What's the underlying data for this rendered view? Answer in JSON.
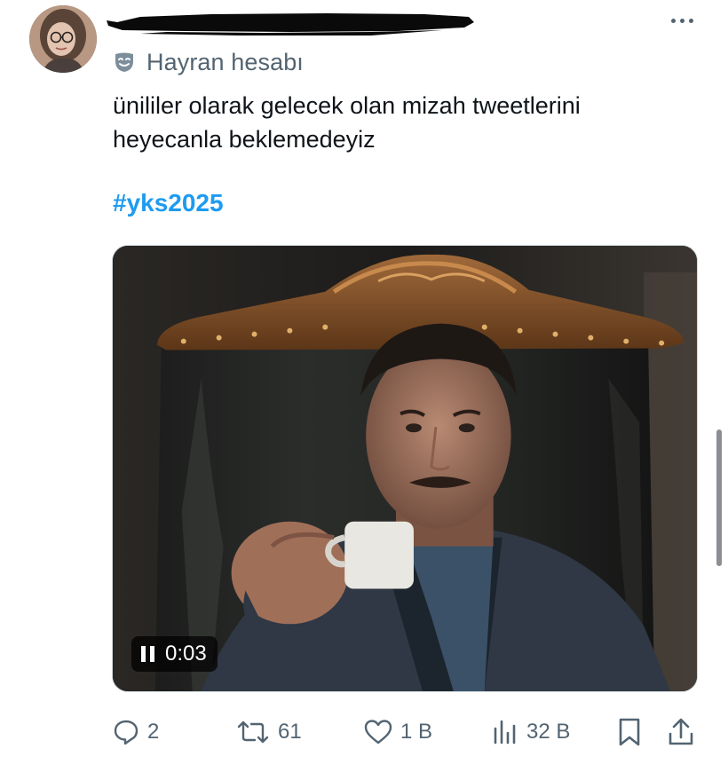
{
  "author": {
    "label": "Hayran hesabı",
    "label_icon": "theater-mask-icon"
  },
  "tweet": {
    "line1": "ünililer olarak gelecek olan mizah tweetlerini",
    "line2": "heyecanla beklemedeyiz",
    "hashtag": "#yks2025"
  },
  "video": {
    "time": "0:03",
    "state_icon": "pause-icon"
  },
  "actions": {
    "replies": "2",
    "retweets": "61",
    "likes": "1 B",
    "views": "32 B"
  },
  "colors": {
    "link": "#1d9bf0",
    "secondary_text": "#536471",
    "primary_text": "#0f1419"
  }
}
